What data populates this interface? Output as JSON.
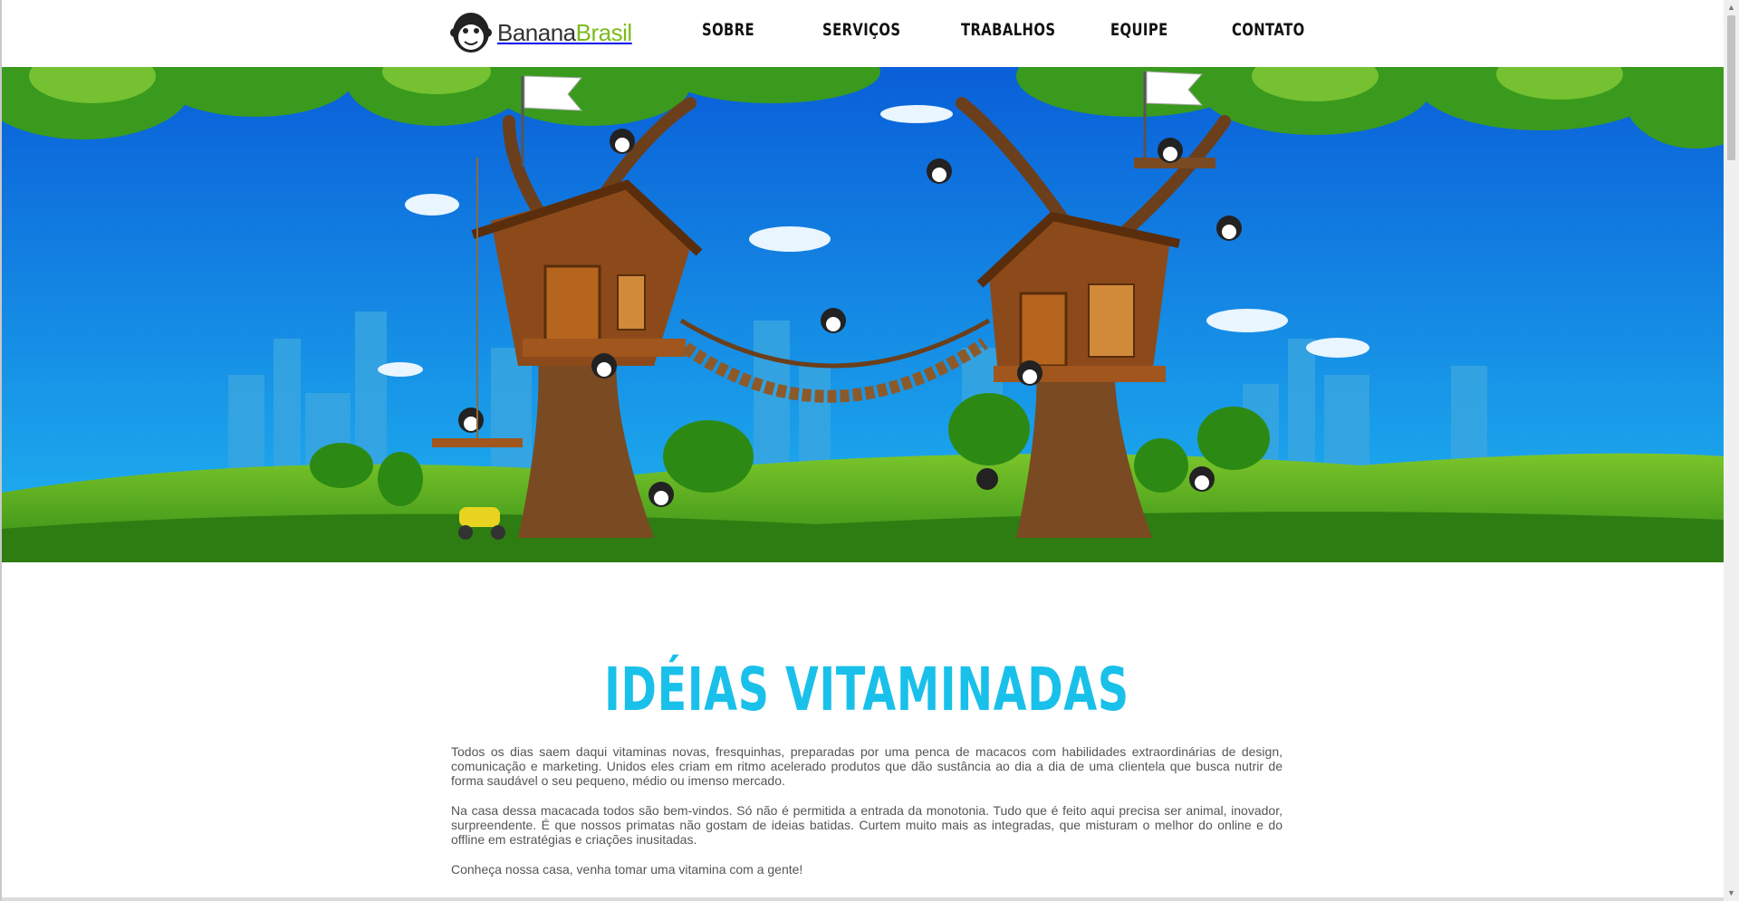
{
  "brand": {
    "name_part1": "Banana",
    "name_part2": "Brasil"
  },
  "nav": {
    "items": [
      {
        "label": "SOBRE"
      },
      {
        "label": "SERVIÇOS"
      },
      {
        "label": "TRABALHOS"
      },
      {
        "label": "EQUIPE"
      },
      {
        "label": "CONTATO"
      }
    ]
  },
  "hero": {
    "scene": "treehouse-monkeys-illustration",
    "flag_left_icon": "flag-icon",
    "flag_right_icon": "flag-icon"
  },
  "content": {
    "headline": "IDÉIAS VITAMINADAS",
    "paragraphs": [
      "Todos os dias saem daqui vitaminas novas, fresquinhas, preparadas por uma penca de macacos com habilidades extraordinárias de design, comunicação e marketing. Unidos eles criam em ritmo acelerado produtos que dão sustância ao dia a dia de uma clientela que busca nutrir de forma saudável o seu pequeno, médio ou imenso mercado.",
      "Na casa dessa macacada todos são bem-vindos. Só não é permitida a entrada da monotonia. Tudo que é feito aqui precisa ser animal, inovador, surpreendente. É que nossos primatas não gostam de ideias batidas. Curtem muito mais as integradas, que misturam o melhor do online e do offline em estratégias e criações inusitadas.",
      "Conheça nossa casa, venha tomar uma vitamina com a gente!"
    ]
  },
  "colors": {
    "headline": "#19c0ea",
    "brand_green": "#7dbb1f",
    "sky_top": "#0a5fd8",
    "sky_bottom": "#1fb4f0",
    "grass": "#3f9b1e"
  }
}
